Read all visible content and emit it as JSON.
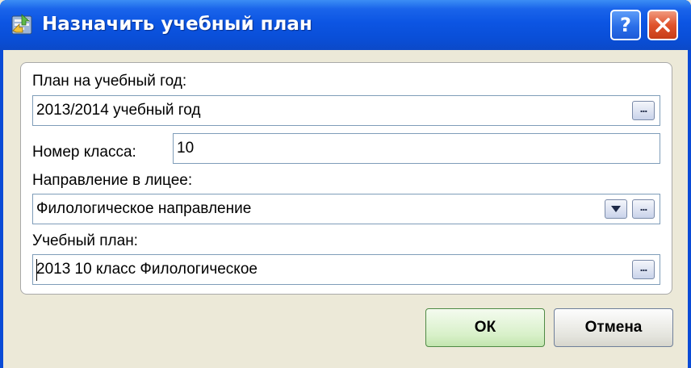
{
  "window": {
    "title": "Назначить учебный план",
    "help_label": "?",
    "icon": "app-icon",
    "help_icon": "question-icon",
    "close_icon": "close-x-icon"
  },
  "form": {
    "plan_year": {
      "label": "План на учебный год:",
      "value": "2013/2014 учебный год",
      "picker": "ellipsis-icon"
    },
    "class_number": {
      "label": "Номер класса:",
      "value": "10"
    },
    "direction": {
      "label": "Направление в лицее:",
      "value": "Филологическое направление",
      "dropdown": "chevron-down-icon",
      "picker": "ellipsis-icon"
    },
    "curriculum": {
      "label": "Учебный план:",
      "value": "2013 10 класс Филологическое",
      "picker": "ellipsis-icon"
    }
  },
  "buttons": {
    "ok": "ОК",
    "cancel": "Отмена"
  },
  "colors": {
    "titlebar": "#0a4fd8",
    "close_button": "#e0542d",
    "ok_button": "#d8f0c9",
    "dialog_background": "#ece9d8"
  }
}
